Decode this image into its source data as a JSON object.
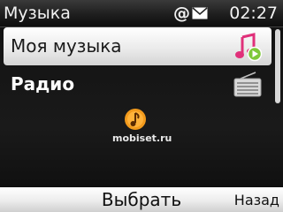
{
  "status_bar": {
    "title": "Музыка",
    "at_symbol": "@",
    "time": "02:27"
  },
  "menu": {
    "items": [
      {
        "label": "Моя музыка",
        "icon": "music-note-play-icon",
        "selected": true
      },
      {
        "label": "Радио",
        "icon": "radio-icon",
        "selected": false
      }
    ]
  },
  "watermark": {
    "text": "mobiset.ru"
  },
  "softkeys": {
    "center": "Выбрать",
    "right": "Назад"
  },
  "colors": {
    "accent_pink": "#e0307a",
    "accent_green": "#7ec83a",
    "selection": "#ffffff",
    "background": "#121212"
  }
}
